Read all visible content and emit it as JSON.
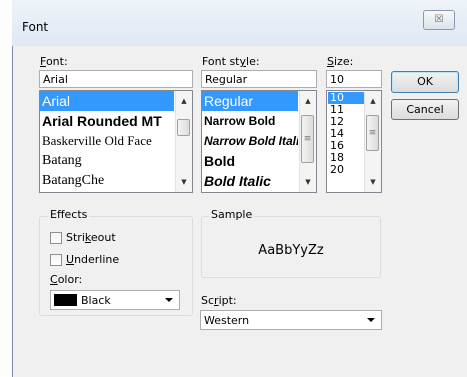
{
  "window": {
    "title": "Font",
    "close_glyph": "☒"
  },
  "font": {
    "label_prefix": "",
    "label_underline": "F",
    "label_rest": "ont:",
    "value": "Arial",
    "items": [
      {
        "text": "Arial",
        "selected": true
      },
      {
        "text": "Arial Rounded MT",
        "selected": false
      },
      {
        "text": "Baskerville Old Face",
        "selected": false
      },
      {
        "text": "Batang",
        "selected": false
      },
      {
        "text": "BatangChe",
        "selected": false
      }
    ]
  },
  "style": {
    "label_prefix": "Font st",
    "label_underline": "y",
    "label_rest": "le:",
    "value": "Regular",
    "items": [
      {
        "text": "Regular",
        "selected": true
      },
      {
        "text": "Narrow Bold",
        "selected": false
      },
      {
        "text": "Narrow Bold Italic",
        "selected": false
      },
      {
        "text": "Bold",
        "selected": false
      },
      {
        "text": "Bold Italic",
        "selected": false
      }
    ]
  },
  "size": {
    "label_prefix": "",
    "label_underline": "S",
    "label_rest": "ize:",
    "value": "10",
    "items": [
      {
        "text": "10",
        "selected": true
      },
      {
        "text": "11",
        "selected": false
      },
      {
        "text": "12",
        "selected": false
      },
      {
        "text": "14",
        "selected": false
      },
      {
        "text": "16",
        "selected": false
      },
      {
        "text": "18",
        "selected": false
      },
      {
        "text": "20",
        "selected": false
      }
    ]
  },
  "buttons": {
    "ok": "OK",
    "cancel": "Cancel"
  },
  "effects": {
    "title": "Effects",
    "strikeout_prefix": "Stri",
    "strikeout_underline": "k",
    "strikeout_rest": "eout",
    "underline_prefix": "",
    "underline_underline": "U",
    "underline_rest": "nderline",
    "color_prefix": "",
    "color_underline": "C",
    "color_rest": "olor:",
    "color_value": "Black",
    "color_swatch": "#000000"
  },
  "sample": {
    "title": "Sample",
    "text": "AaBbYyZz"
  },
  "script": {
    "label_prefix": "Sc",
    "label_underline": "r",
    "label_rest": "ipt:",
    "value": "Western"
  },
  "icons": {
    "up": "▲",
    "down": "▼",
    "grip": "≡"
  },
  "colors": {
    "selection": "#3399ff"
  }
}
